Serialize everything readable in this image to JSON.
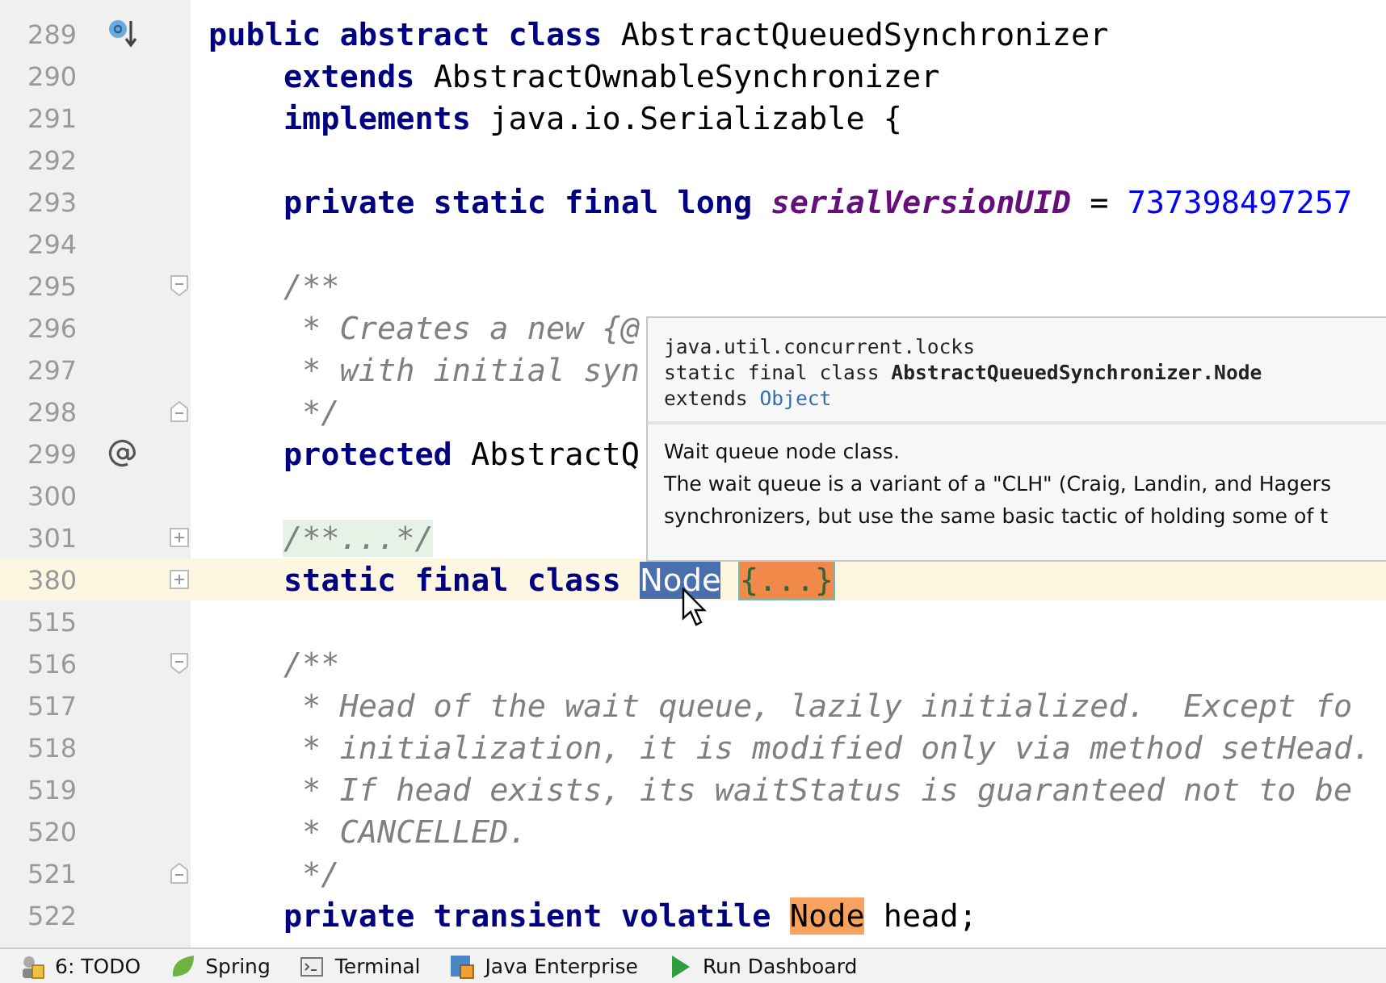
{
  "editor": {
    "lines": [
      {
        "number": "289",
        "gutter_icon": {
          "kind": "implemented"
        },
        "current": false,
        "tokens": [
          {
            "kind": "keyword",
            "text": "public abstract class "
          },
          {
            "kind": "plain",
            "text": "AbstractQueuedSynchronizer"
          }
        ]
      },
      {
        "number": "290",
        "current": false,
        "tokens": [
          {
            "kind": "keyword",
            "text": "    extends "
          },
          {
            "kind": "plain",
            "text": "AbstractOwnableSynchronizer"
          }
        ]
      },
      {
        "number": "291",
        "current": false,
        "tokens": [
          {
            "kind": "keyword",
            "text": "    implements "
          },
          {
            "kind": "plain",
            "text": "java.io.Serializable {"
          }
        ]
      },
      {
        "number": "292",
        "current": false
      },
      {
        "number": "293",
        "current": false,
        "tokens": [
          {
            "kind": "keyword",
            "text": "    private static final long "
          },
          {
            "kind": "field",
            "text": "serialVersionUID"
          },
          {
            "kind": "plain",
            "text": " = "
          },
          {
            "kind": "number",
            "text": "737398497257"
          }
        ]
      },
      {
        "number": "294",
        "current": false
      },
      {
        "number": "295",
        "fold": {
          "kind": "start"
        },
        "current": false,
        "tokens": [
          {
            "kind": "comment",
            "text": "    /**"
          }
        ]
      },
      {
        "number": "296",
        "current": false,
        "tokens": [
          {
            "kind": "comment",
            "text": "     * Creates a new {@"
          }
        ]
      },
      {
        "number": "297",
        "current": false,
        "tokens": [
          {
            "kind": "comment",
            "text": "     * with initial syn"
          }
        ]
      },
      {
        "number": "298",
        "fold": {
          "kind": "end"
        },
        "current": false,
        "tokens": [
          {
            "kind": "comment",
            "text": "     */"
          }
        ]
      },
      {
        "number": "299",
        "gutter_icon": {
          "kind": "annotation"
        },
        "current": false,
        "tokens": [
          {
            "kind": "keyword",
            "text": "    protected "
          },
          {
            "kind": "plain",
            "text": "AbstractQ"
          }
        ]
      },
      {
        "number": "300",
        "current": false
      },
      {
        "number": "301",
        "fold": {
          "kind": "collapsed"
        },
        "current": false,
        "tokens": [
          {
            "kind": "doc_folded",
            "text": "    /**...*/"
          }
        ]
      },
      {
        "number": "380",
        "fold": {
          "kind": "collapsed"
        },
        "current": true,
        "tokens": [
          {
            "kind": "keyword",
            "text": "    static final class "
          },
          {
            "kind": "selected",
            "text": "Node"
          },
          {
            "kind": "folded",
            "text": " {...}"
          }
        ]
      },
      {
        "number": "515",
        "current": false
      },
      {
        "number": "516",
        "fold": {
          "kind": "start"
        },
        "current": false,
        "tokens": [
          {
            "kind": "comment",
            "text": "    /**"
          }
        ]
      },
      {
        "number": "517",
        "current": false,
        "tokens": [
          {
            "kind": "comment",
            "text": "     * Head of the wait queue, lazily initialized.  Except fo"
          }
        ]
      },
      {
        "number": "518",
        "current": false,
        "tokens": [
          {
            "kind": "comment",
            "text": "     * initialization, it is modified only via method setHead."
          }
        ]
      },
      {
        "number": "519",
        "current": false,
        "tokens": [
          {
            "kind": "comment",
            "text": "     * If head exists, its waitStatus is guaranteed not to be"
          }
        ]
      },
      {
        "number": "520",
        "current": false,
        "tokens": [
          {
            "kind": "comment",
            "text": "     * CANCELLED."
          }
        ]
      },
      {
        "number": "521",
        "fold": {
          "kind": "end"
        },
        "current": false,
        "tokens": [
          {
            "kind": "comment",
            "text": "     */"
          }
        ]
      },
      {
        "number": "522",
        "current": false,
        "tokens": [
          {
            "kind": "keyword",
            "text": "    private transient volatile "
          },
          {
            "kind": "match",
            "text": "Node"
          },
          {
            "kind": "plain",
            "text": " head;"
          }
        ]
      }
    ]
  },
  "doc_popup": {
    "package": "java.util.concurrent.locks",
    "signature": "static final class **AbstractQueuedSynchronizer.Node**",
    "extends_label": "extends",
    "extends_link": "Object",
    "body": [
      "Wait queue node class.",
      "The wait queue is a variant of a \"CLH\" (Craig, Landin, and Hagers",
      "synchronizers, but use the same basic tactic of holding some of t"
    ]
  },
  "status_bar": [
    {
      "kind": "todo",
      "label": "6: TODO"
    },
    {
      "kind": "spring",
      "label": "Spring"
    },
    {
      "kind": "terminal",
      "label": "Terminal"
    },
    {
      "kind": "enterprise",
      "label": "Java Enterprise"
    },
    {
      "kind": "run",
      "label": "Run Dashboard"
    }
  ]
}
